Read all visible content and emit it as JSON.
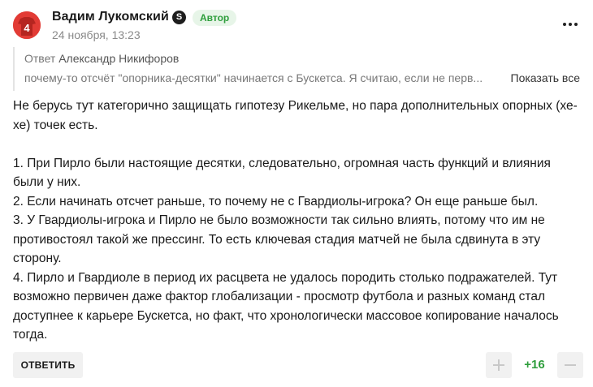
{
  "comment": {
    "author": "Вадим Лукомский",
    "badge_letter": "S",
    "author_tag": "Автор",
    "timestamp": "24 ноября, 13:23",
    "avatar_number": "4",
    "quote": {
      "prefix": "Ответ",
      "name": "Александр Никифоров",
      "text": "почему-то отсчёт \"опорника-десятки\" начинается с Бускетса. Я считаю, если не перв...",
      "show_all_label": "Показать все"
    },
    "paragraphs": [
      "Не берусь тут категорично защищать гипотезу Рикельме, но пара дополнительных опорных (хе-хе) точек есть.",
      "",
      "1. При Пирло были настоящие десятки, следовательно, огромная часть функций и влияния были у них.",
      "2. Если начинать отсчет раньше, то почему не с Гвардиолы-игрока? Он еще раньше был.",
      "3. У Гвардиолы-игрока и Пирло не было возможности так сильно влиять, потому что им не противостоял такой же прессинг. То есть ключевая стадия матчей не была сдвинута в эту сторону.",
      "4. Пирло и Гвардиоле в период их расцвета не удалось породить столько подражателей. Тут возможно первичен даже фактор глобализации - просмотр футбола и разных команд стал доступнее к карьере Бускетса, но факт, что хронологически массовое копирование началось тогда."
    ],
    "reply_label": "ОТВЕТИТЬ",
    "score": "+16"
  },
  "colors": {
    "accent_green": "#2e9e3c",
    "tag_bg": "#e7f5e8",
    "avatar_red": "#e23b35",
    "button_bg": "#f1f1f1",
    "muted_text": "#8a8a8a"
  },
  "icons": {
    "avatar": "football-jersey-icon",
    "badge": "sports-logo-icon",
    "more": "more-dots-icon",
    "upvote": "plus-icon",
    "downvote": "minus-icon"
  }
}
